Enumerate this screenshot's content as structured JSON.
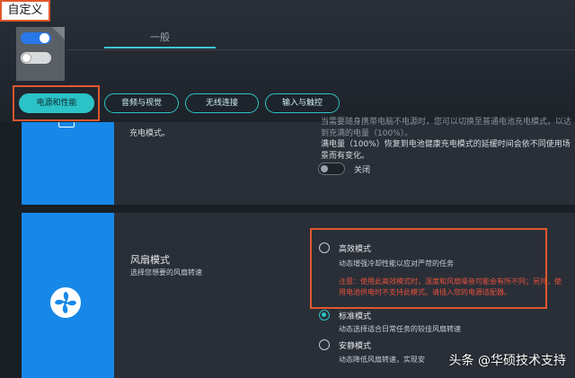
{
  "window": {
    "title": "自定义"
  },
  "tabs": [
    {
      "label": "一般"
    }
  ],
  "categories": [
    {
      "label": "电源和性能",
      "active": true
    },
    {
      "label": "音频与视觉",
      "active": false
    },
    {
      "label": "无线连接",
      "active": false
    },
    {
      "label": "输入与触控",
      "active": false
    }
  ],
  "battery_card": {
    "left_text": "充电模式。",
    "lines": [
      "当需要随身携带电脑不电源时，您可以切换至普通电池充电模式，以达到充满的电量（100%）。",
      "满电量（100%）恢复到电池健康充电模式的延缓时间会依不同使用场景而有变化。"
    ],
    "toggle_label": "关闭",
    "toggle_on": false
  },
  "fan_card": {
    "title": "风扇模式",
    "subtitle": "选择您想要的风扇转速",
    "options": [
      {
        "title": "高效模式",
        "desc": "动态增强冷却性能以应对严苛的任务",
        "selected": false
      },
      {
        "title": "标准模式",
        "desc": "动态选择适合日常任务的较佳风扇转速",
        "selected": true
      },
      {
        "title": "安静模式",
        "desc": "动态降低风扇转速，实现安",
        "selected": false
      }
    ],
    "warning": "注意：使用此高效模式时，温度和风扇噪音可能会有所不同；另外，使用电池供电时不支持此模式。请插入您的电源适配器。"
  },
  "watermark": {
    "text": "头条 @华硕技术支持"
  },
  "colors": {
    "accent": "#2bc3c8",
    "highlight": "#e0572e",
    "side_blue": "#1788e8",
    "warning": "#e8503c"
  }
}
